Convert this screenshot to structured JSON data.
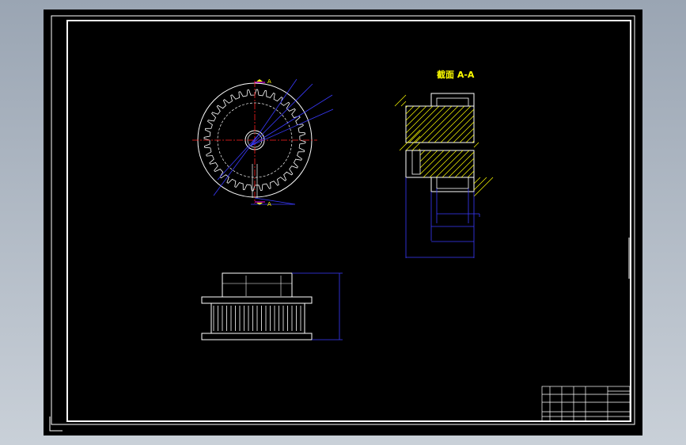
{
  "section_title": "截面 A-A",
  "section_mark_top": "A",
  "section_mark_bottom": "A",
  "colors": {
    "line": "#ffffff",
    "dimension": "#3a3aff",
    "centerline": "#ff2020",
    "hatch": "#ffff00",
    "label": "#ff00ff"
  }
}
